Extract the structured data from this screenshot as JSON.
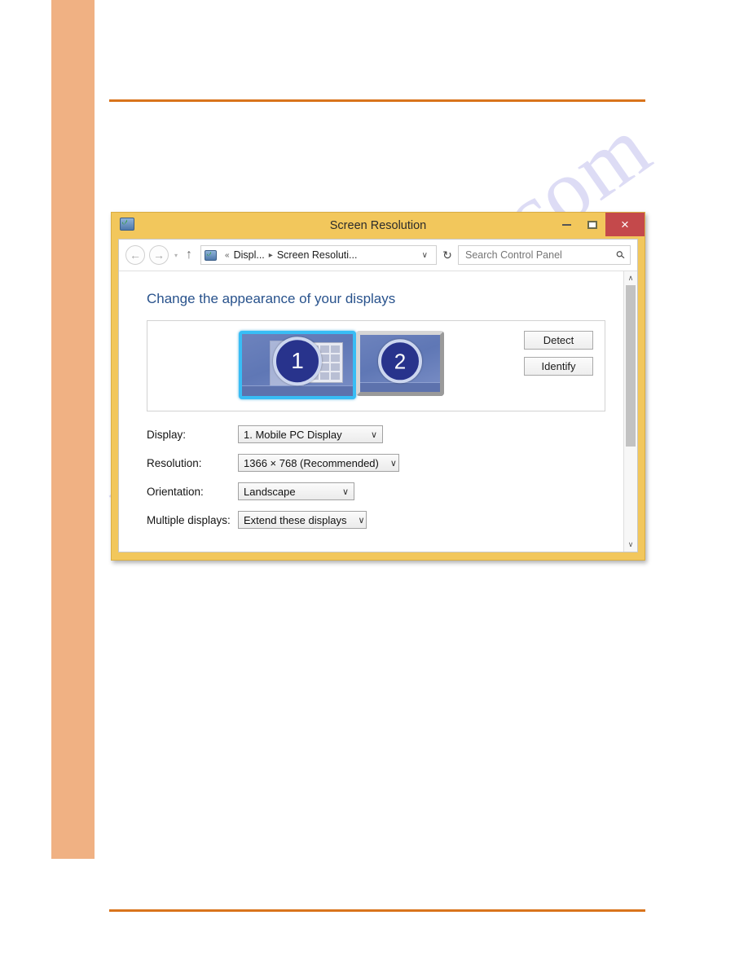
{
  "page": {
    "watermark": "manualshive.com"
  },
  "window": {
    "title": "Screen Resolution",
    "icon": "display-monitor-icon",
    "controls": {
      "minimize": "–",
      "maximize": "□",
      "close": "×"
    },
    "nav": {
      "back_icon": "←",
      "forward_icon": "→",
      "history_caret": "▾",
      "up_icon": "↑",
      "breadcrumb_prefix": "«",
      "breadcrumb": [
        "Displ...",
        "Screen Resoluti..."
      ],
      "breadcrumb_separator": "▸",
      "address_caret": "∨",
      "refresh_icon": "↻"
    },
    "search": {
      "placeholder": "Search Control Panel",
      "icon": "magnifier-icon"
    },
    "scrollbar": {
      "up_icon": "∧",
      "down_icon": "∨"
    }
  },
  "content": {
    "heading": "Change the appearance of your displays",
    "monitors": [
      {
        "number": "1",
        "state": "selected"
      },
      {
        "number": "2",
        "state": "unselected"
      }
    ],
    "buttons": {
      "detect": "Detect",
      "identify": "Identify"
    },
    "fields": [
      {
        "label": "Display:",
        "value": "1. Mobile PC Display",
        "caret": "∨"
      },
      {
        "label": "Resolution:",
        "value": "1366 × 768 (Recommended)",
        "caret": "∨"
      },
      {
        "label": "Orientation:",
        "value": "Landscape",
        "caret": "∨"
      },
      {
        "label": "Multiple displays:",
        "value": "Extend these displays",
        "caret": "∨"
      }
    ]
  }
}
